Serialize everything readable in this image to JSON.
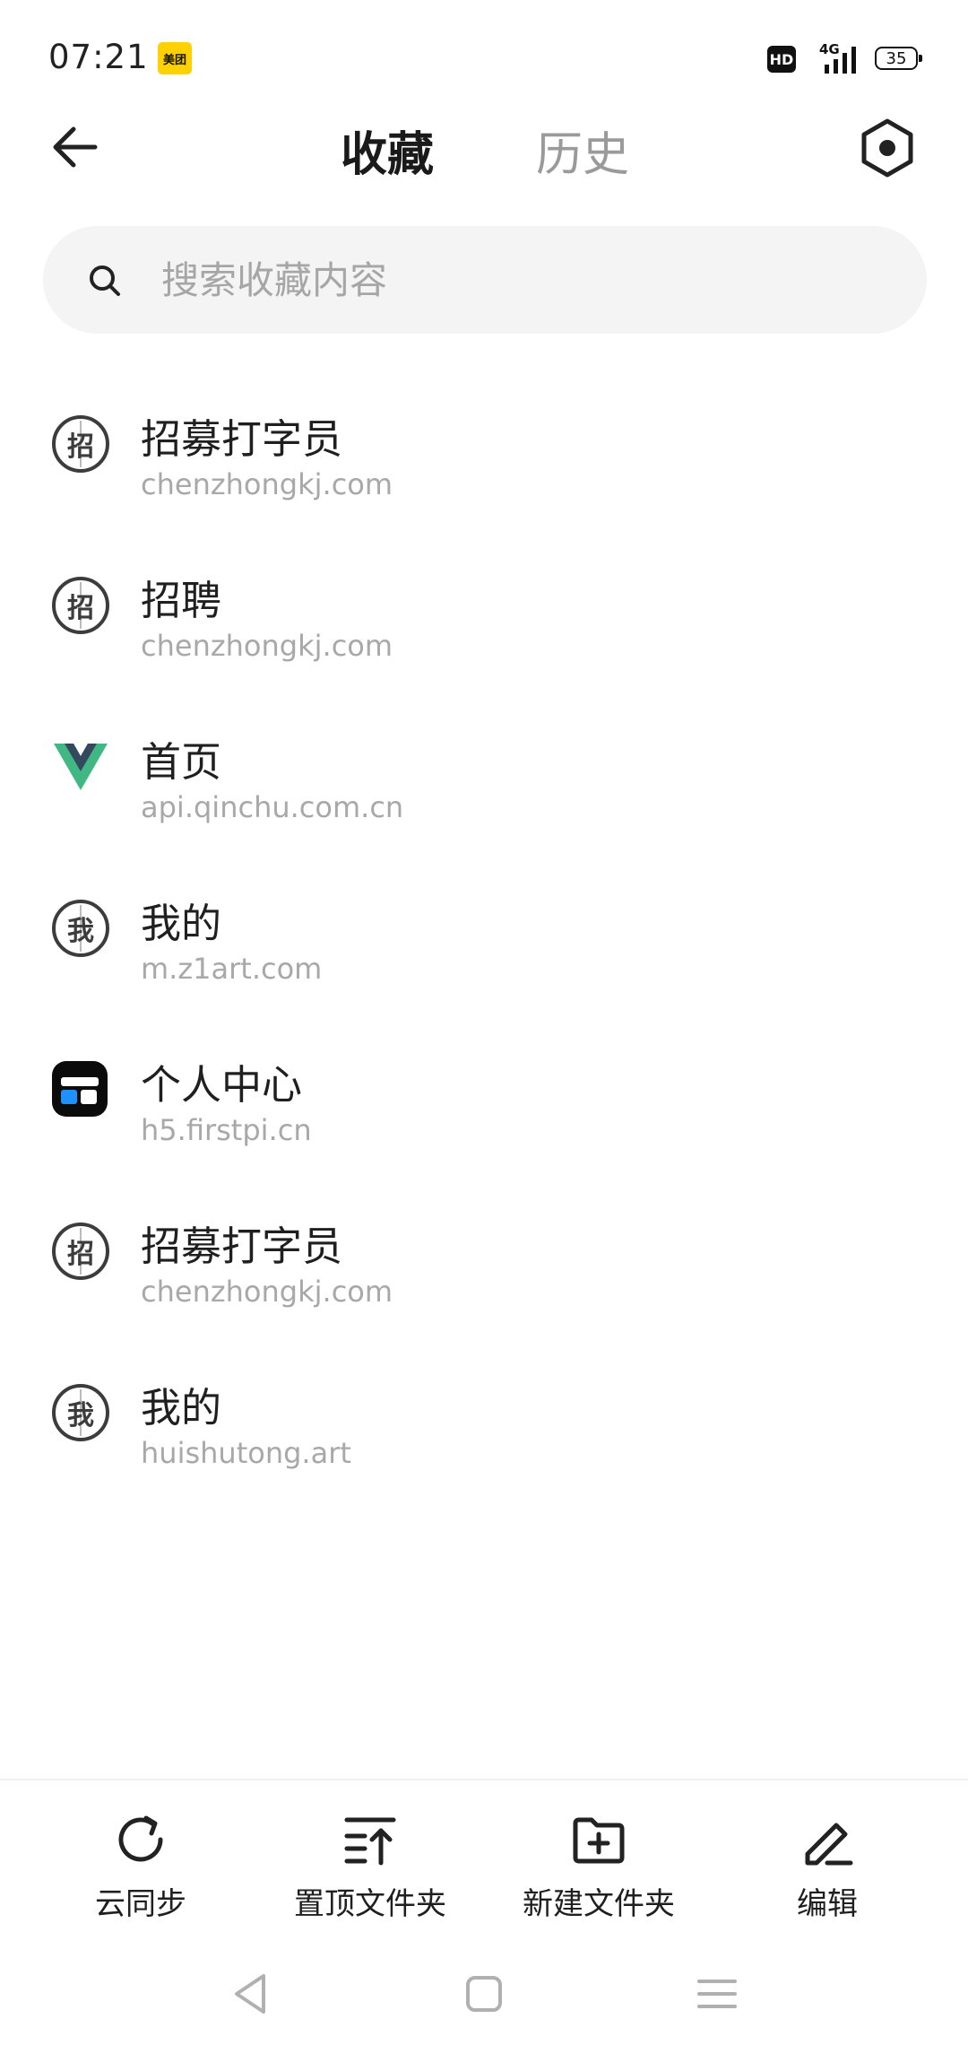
{
  "status_bar": {
    "time": "07:21",
    "app_badge": "美团",
    "hd": "HD",
    "network": "4G",
    "battery": "35"
  },
  "nav": {
    "tabs": [
      {
        "label": "收藏",
        "active": true
      },
      {
        "label": "历史",
        "active": false
      }
    ],
    "icons": {
      "back": "back-arrow-icon",
      "settings": "settings-hex-icon"
    }
  },
  "search": {
    "placeholder": "搜索收藏内容",
    "value": ""
  },
  "bookmarks": [
    {
      "title": "招募打字员",
      "url": "chenzhongkj.com",
      "icon": "globe-icon",
      "glyph": "招"
    },
    {
      "title": "招聘",
      "url": "chenzhongkj.com",
      "icon": "globe-icon",
      "glyph": "招"
    },
    {
      "title": "首页",
      "url": "api.qinchu.com.cn",
      "icon": "vue-logo-icon",
      "glyph": ""
    },
    {
      "title": "我的",
      "url": "m.z1art.com",
      "icon": "globe-icon",
      "glyph": "我"
    },
    {
      "title": "个人中心",
      "url": "h5.firstpi.cn",
      "icon": "app-icon",
      "glyph": ""
    },
    {
      "title": "招募打字员",
      "url": "chenzhongkj.com",
      "icon": "globe-icon",
      "glyph": "招"
    },
    {
      "title": "我的",
      "url": "huishutong.art",
      "icon": "globe-icon",
      "glyph": "我"
    }
  ],
  "toolbar": {
    "sync_label": "云同步",
    "pin_label": "置顶文件夹",
    "new_folder_label": "新建文件夹",
    "edit_label": "编辑"
  },
  "colors": {
    "text": "#1f1f1f",
    "muted": "#a8a8a8",
    "search_bg": "#f4f4f4",
    "vue_green": "#41b883",
    "vue_dark": "#35495e"
  }
}
